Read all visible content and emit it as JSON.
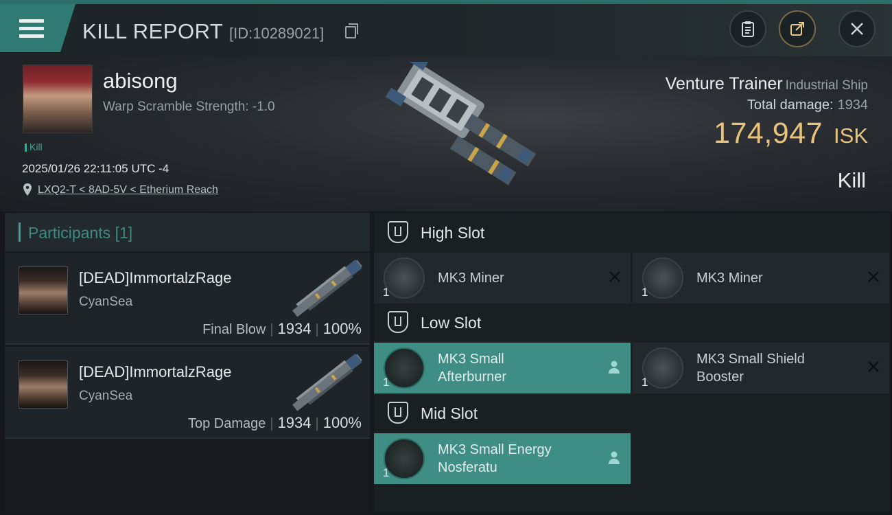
{
  "header": {
    "title": "KILL REPORT",
    "report_id": "[ID:10289021]"
  },
  "victim": {
    "name": "abisong",
    "warp_scramble": "Warp Scramble Strength: -1.0",
    "tag": "Kill",
    "datetime": "2025/01/26 22:11:05 UTC -4",
    "location": "LXQ2-T < 8AD-5V < Etherium Reach"
  },
  "ship": {
    "name": "Venture Trainer",
    "class": "Industrial Ship",
    "total_damage_label": "Total damage:",
    "total_damage_value": "1934",
    "isk_value": "174,947",
    "isk_unit": "ISK",
    "result": "Kill"
  },
  "participants": {
    "heading": "Participants",
    "count": "[1]",
    "rows": [
      {
        "name": "[DEAD]ImmortalzRage",
        "corp": "CyanSea",
        "role": "Final Blow",
        "damage": "1934",
        "percent": "100%"
      },
      {
        "name": "[DEAD]ImmortalzRage",
        "corp": "CyanSea",
        "role": "Top Damage",
        "damage": "1934",
        "percent": "100%"
      }
    ]
  },
  "slots": {
    "high": {
      "label": "High Slot",
      "modules": [
        {
          "name": "MK3 Miner",
          "qty": "1",
          "state": "destroyed"
        },
        {
          "name": "MK3 Miner",
          "qty": "1",
          "state": "destroyed"
        }
      ]
    },
    "low": {
      "label": "Low Slot",
      "modules": [
        {
          "name1": "MK3 Small",
          "name2": "Afterburner",
          "qty": "1",
          "state": "dropped"
        },
        {
          "name1": "MK3 Small Shield",
          "name2": "Booster",
          "qty": "1",
          "state": "destroyed"
        }
      ]
    },
    "mid": {
      "label": "Mid Slot",
      "modules": [
        {
          "name1": "MK3 Small Energy",
          "name2": "Nosferatu",
          "qty": "1",
          "state": "dropped"
        }
      ]
    }
  },
  "icons": [
    "menu-icon",
    "copy-icon",
    "clipboard-icon",
    "share-icon",
    "close-icon",
    "location-pin-icon",
    "slot-shield-icon",
    "destroyed-x-icon",
    "pilot-icon"
  ],
  "colors": {
    "accent": "#3f8e85",
    "isk": "#e9c27c",
    "teal_text": "#3fa597"
  }
}
